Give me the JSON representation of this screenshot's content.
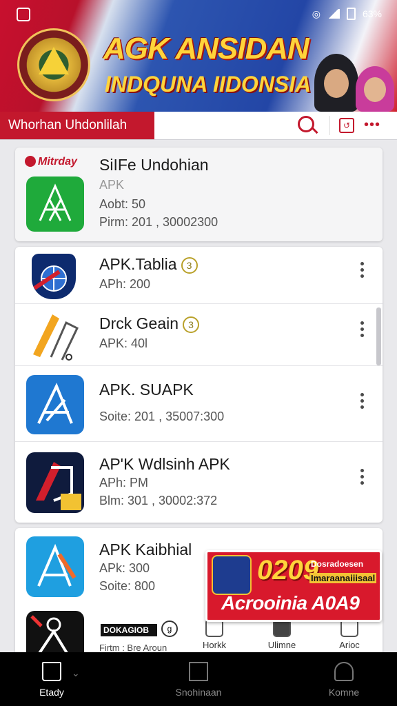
{
  "status_bar": {
    "battery": "63%"
  },
  "banner": {
    "title": "AGK ANSIDAN",
    "subtitle": "INDQUNA IIDONSIA"
  },
  "tab_bar": {
    "label": "Whorhan Uhdonlilah"
  },
  "featured": {
    "brand": "Mitrday",
    "name": "SiIFe Undohian",
    "type": "APK",
    "line1": "Aobt: 50",
    "line2": "Pirm: 201 , 30002300"
  },
  "apps": [
    {
      "name": "APK.Tablia",
      "badge": "3",
      "meta1": "APh: 200",
      "meta2": ""
    },
    {
      "name": "Drck Geain",
      "badge": "3",
      "meta1": "APK: 40l",
      "meta2": ""
    },
    {
      "name": "APK. SUAPK",
      "badge": "",
      "meta1": "",
      "meta2": "Soite: 201 , 35007:300"
    },
    {
      "name": "AP'K Wdlsinh APK",
      "badge": "",
      "meta1": "APh: PM",
      "meta2": "Blm: 301 , 30002:372"
    },
    {
      "name": "APK Kaibhial",
      "badge": "",
      "meta1": "APk: 300",
      "meta2": "Soite: 800"
    }
  ],
  "ad": {
    "number": "0209",
    "line1": "Dosradoesen",
    "line2": "Imaraanaiiisaal",
    "footer": "Acrooinia A0A9"
  },
  "partial_row": {
    "pill": "DOKAGIOB",
    "text": "Firtm : Bre Aroun",
    "actions": [
      "Horkk",
      "Ulimne",
      "Arioc"
    ]
  },
  "nav": {
    "items": [
      "Etady",
      "Snohinaan",
      "Komne"
    ]
  }
}
